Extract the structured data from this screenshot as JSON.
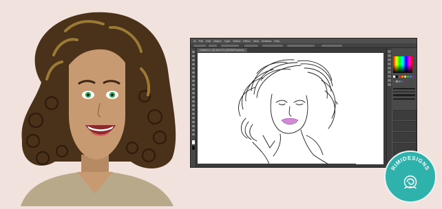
{
  "menu": {
    "items": [
      "Ai",
      "File",
      "Edit",
      "Object",
      "Type",
      "Select",
      "Effect",
      "View",
      "Window",
      "Help"
    ]
  },
  "document_tab": {
    "label": "Untitled-1 @ 66.67% (RGB/Preview)"
  },
  "brand": {
    "badge_text": "RIMIDESIGNS",
    "badge_color": "#2fb1ac"
  },
  "colors": {
    "background": "#f1e2dd",
    "hair": "#4a3119",
    "hair_highlight": "#9a7a34",
    "skin": "#c89a72",
    "eyes": "#3cab5b",
    "shirt": "#b9a98b",
    "lips_sketch": "#d08ad6"
  }
}
